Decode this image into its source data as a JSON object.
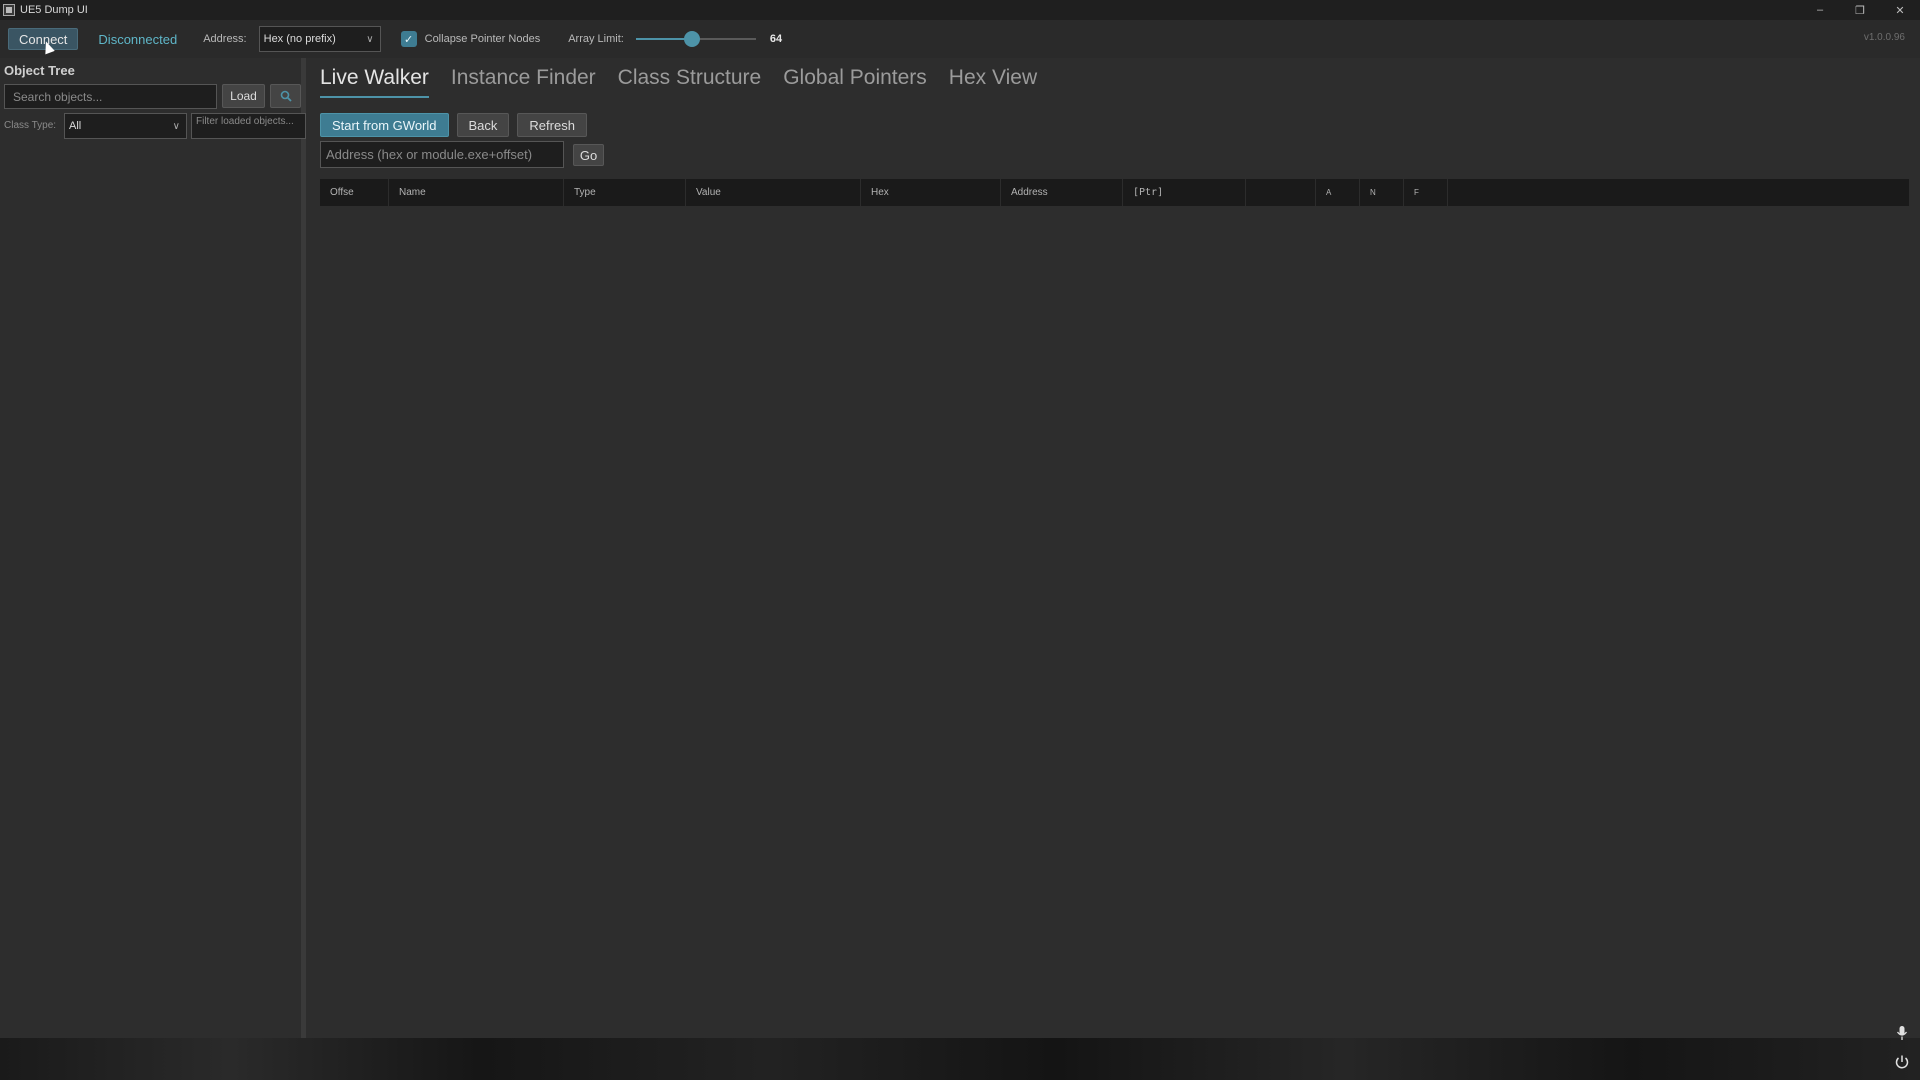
{
  "window": {
    "title": "UE5 Dump UI",
    "controls": [
      "–",
      "❐",
      "✕"
    ]
  },
  "toolbar": {
    "connect_label": "Connect",
    "status": "Disconnected",
    "address_label": "Address:",
    "address_value": "Hex (no prefix)",
    "collapse_checked": true,
    "collapse_label": "Collapse Pointer Nodes",
    "array_limit_label": "Array Limit:",
    "array_limit_value": "64",
    "array_limit_fraction": 0.46,
    "version": "v1.0.0.96"
  },
  "sidebar": {
    "title": "Object Tree",
    "search_placeholder": "Search objects...",
    "load_label": "Load",
    "class_type_label": "Class Type:",
    "class_type_value": "All",
    "filter_placeholder": "Filter loaded objects..."
  },
  "tabs": [
    {
      "label": "Live Walker",
      "active": true
    },
    {
      "label": "Instance Finder",
      "active": false
    },
    {
      "label": "Class Structure",
      "active": false
    },
    {
      "label": "Global Pointers",
      "active": false
    },
    {
      "label": "Hex View",
      "active": false
    }
  ],
  "actions": {
    "start_label": "Start from GWorld",
    "back_label": "Back",
    "refresh_label": "Refresh",
    "address_placeholder": "Address (hex or module.exe+offset)",
    "go_label": "Go"
  },
  "table": {
    "columns": [
      "Offse",
      "Name",
      "Type",
      "Value",
      "Hex",
      "Address",
      "[Ptr]",
      "",
      "A",
      "N",
      "F",
      ""
    ]
  },
  "colors": {
    "accent": "#4d93a8",
    "status": "#5fb6c8",
    "background": "#2d2d2d"
  }
}
